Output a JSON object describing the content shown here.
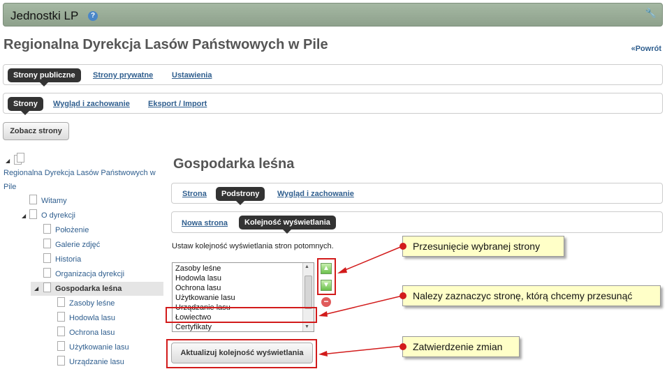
{
  "portlet": {
    "title": "Jednostki LP",
    "help": "?",
    "wrench": "🔧"
  },
  "header": {
    "org_title": "Regionalna Dyrekcja Lasów Państwowych w Pile",
    "back": "«Powrót"
  },
  "tabs1": [
    "Strony publiczne",
    "Strony prywatne",
    "Ustawienia"
  ],
  "tabs2": [
    "Strony",
    "Wygląd i zachowanie",
    "Eksport / Import"
  ],
  "view_pages_button": "Zobacz strony",
  "tree": {
    "root_line1": "Regionalna Dyrekcja Lasów Państwowych w",
    "root_line2": "Pile",
    "items": [
      "Witamy",
      "O dyrekcji",
      "Położenie",
      "Galerie zdjęć",
      "Historia",
      "Organizacja dyrekcji",
      "Gospodarka leśna",
      "Zasoby leśne",
      "Hodowla lasu",
      "Ochrona lasu",
      "Użytkowanie lasu",
      "Urządzanie lasu"
    ]
  },
  "main": {
    "title": "Gospodarka leśna",
    "tabs3": [
      "Strona",
      "Podstrony",
      "Wygląd i zachowanie"
    ],
    "tabs4": [
      "Nowa strona",
      "Kolejność wyświetlania"
    ],
    "instructions": "Ustaw kolejność wyświetlania stron potomnych.",
    "list_options": [
      "Zasoby leśne",
      "Hodowla lasu",
      "Ochrona lasu",
      "Użytkowanie lasu",
      "Urządzanie lasu",
      "Łowiectwo",
      "Certyfikaty"
    ],
    "update_button": "Aktualizuj kolejność wyświetlania"
  },
  "callouts": {
    "move": "Przesunięcie wybranej strony",
    "select": "Nalezy zaznaczyc stronę, którą chcemy przesunąć",
    "confirm": "Zatwierdzenie zmian"
  },
  "colors": {
    "accent_red": "#d21b1b",
    "link": "#2f5e8e",
    "callout_bg": "#ffffc8",
    "portlet_bar": "#9aad98"
  }
}
